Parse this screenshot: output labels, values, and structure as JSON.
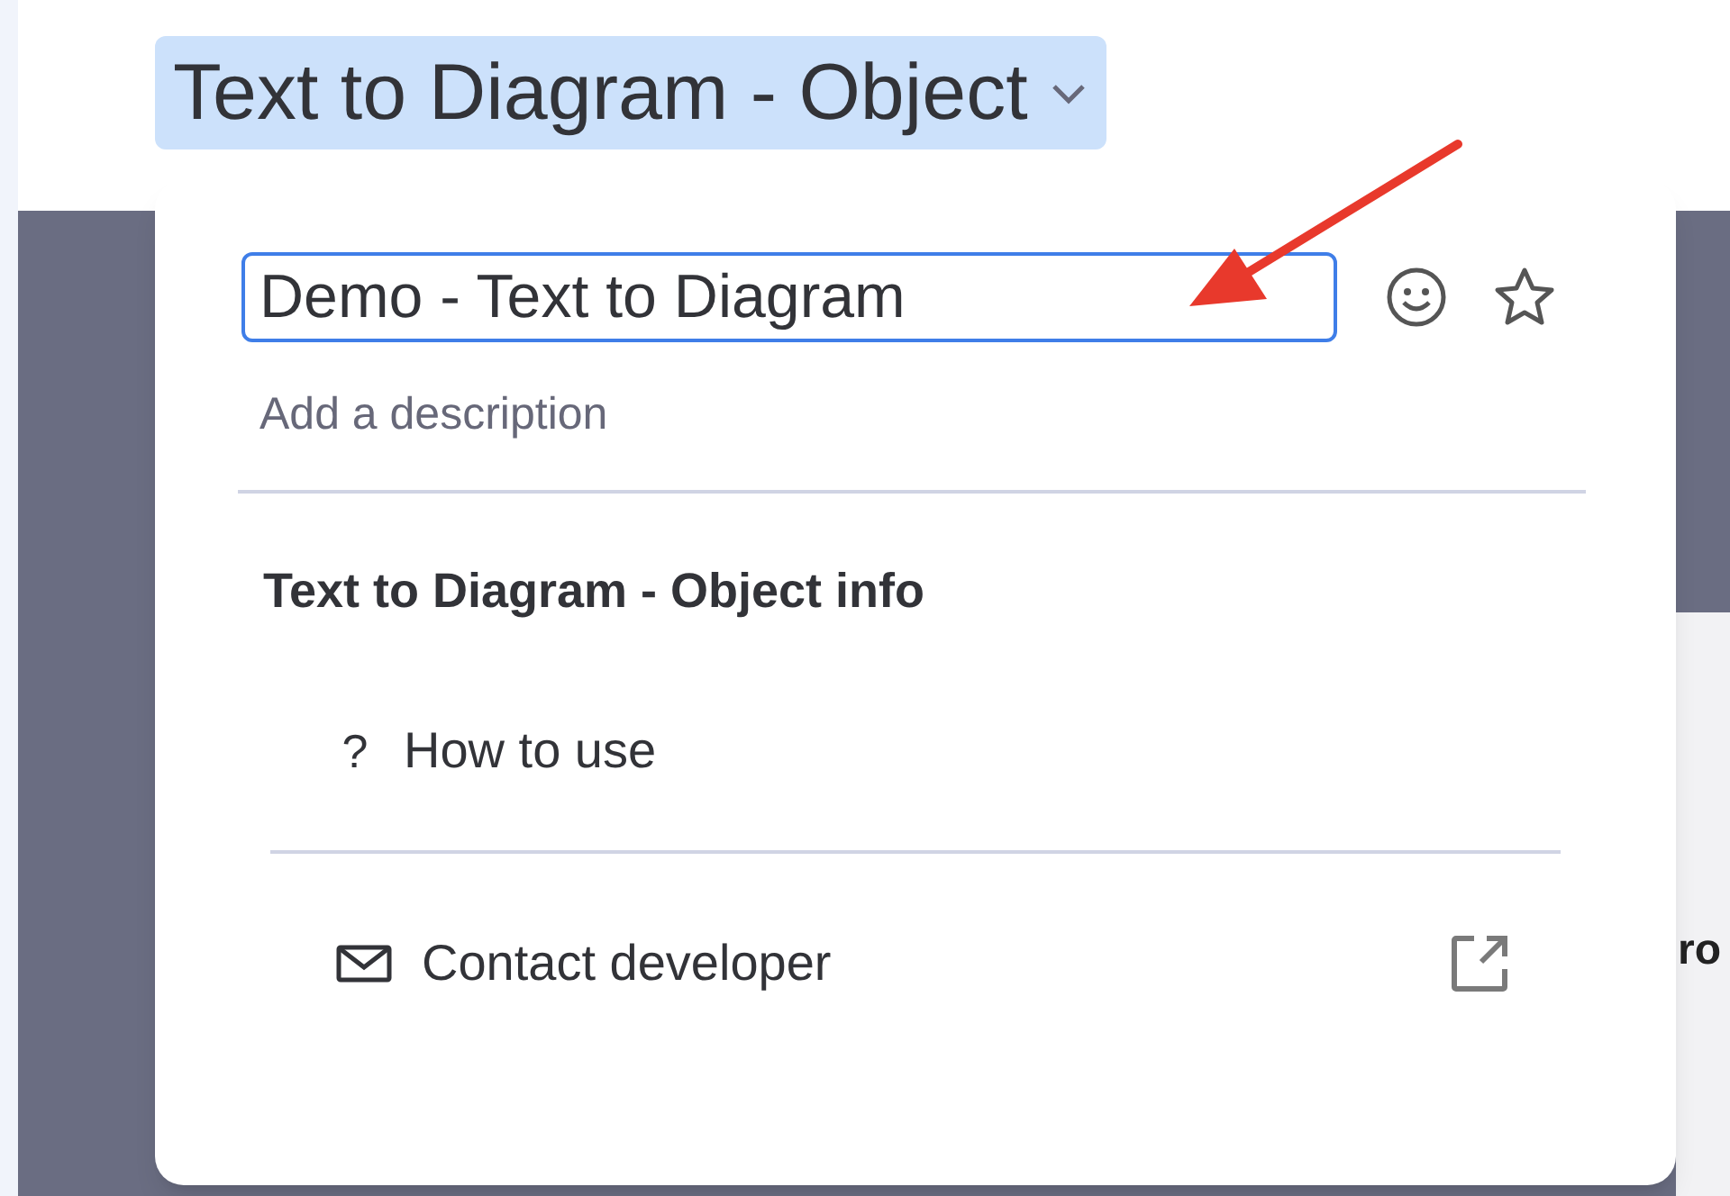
{
  "board_title": {
    "text": "Text to Diagram - Object",
    "selected": true
  },
  "popup": {
    "name_field": {
      "value": "Demo - Text to Diagram"
    },
    "description": {
      "placeholder": "Add a description"
    },
    "info_heading": "Text to Diagram - Object info",
    "items": [
      {
        "kind": "help",
        "icon": "?",
        "label": "How to use"
      },
      {
        "kind": "contact",
        "label": "Contact developer"
      }
    ]
  },
  "background": {
    "heading_fragment": "ro"
  }
}
